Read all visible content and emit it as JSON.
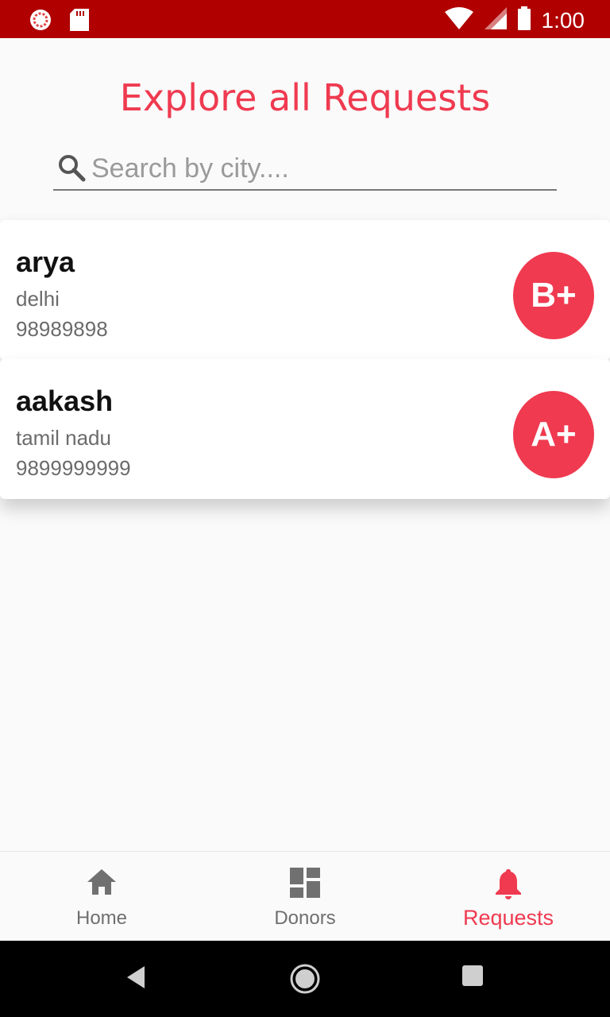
{
  "status_bar": {
    "time": "1:00"
  },
  "page": {
    "title": "Explore all Requests"
  },
  "search": {
    "placeholder": "Search by city...."
  },
  "requests": [
    {
      "name": "arya",
      "city": "delhi",
      "phone": "98989898",
      "blood_group": "B+"
    },
    {
      "name": "aakash",
      "city": "tamil nadu",
      "phone": "9899999999",
      "blood_group": "A+"
    }
  ],
  "bottom_nav": {
    "items": [
      {
        "label": "Home",
        "icon": "home-icon"
      },
      {
        "label": "Donors",
        "icon": "dashboard-icon"
      },
      {
        "label": "Requests",
        "icon": "bell-icon",
        "active": true
      }
    ]
  },
  "colors": {
    "accent": "#ef3a50",
    "status_bar": "#b00000"
  }
}
